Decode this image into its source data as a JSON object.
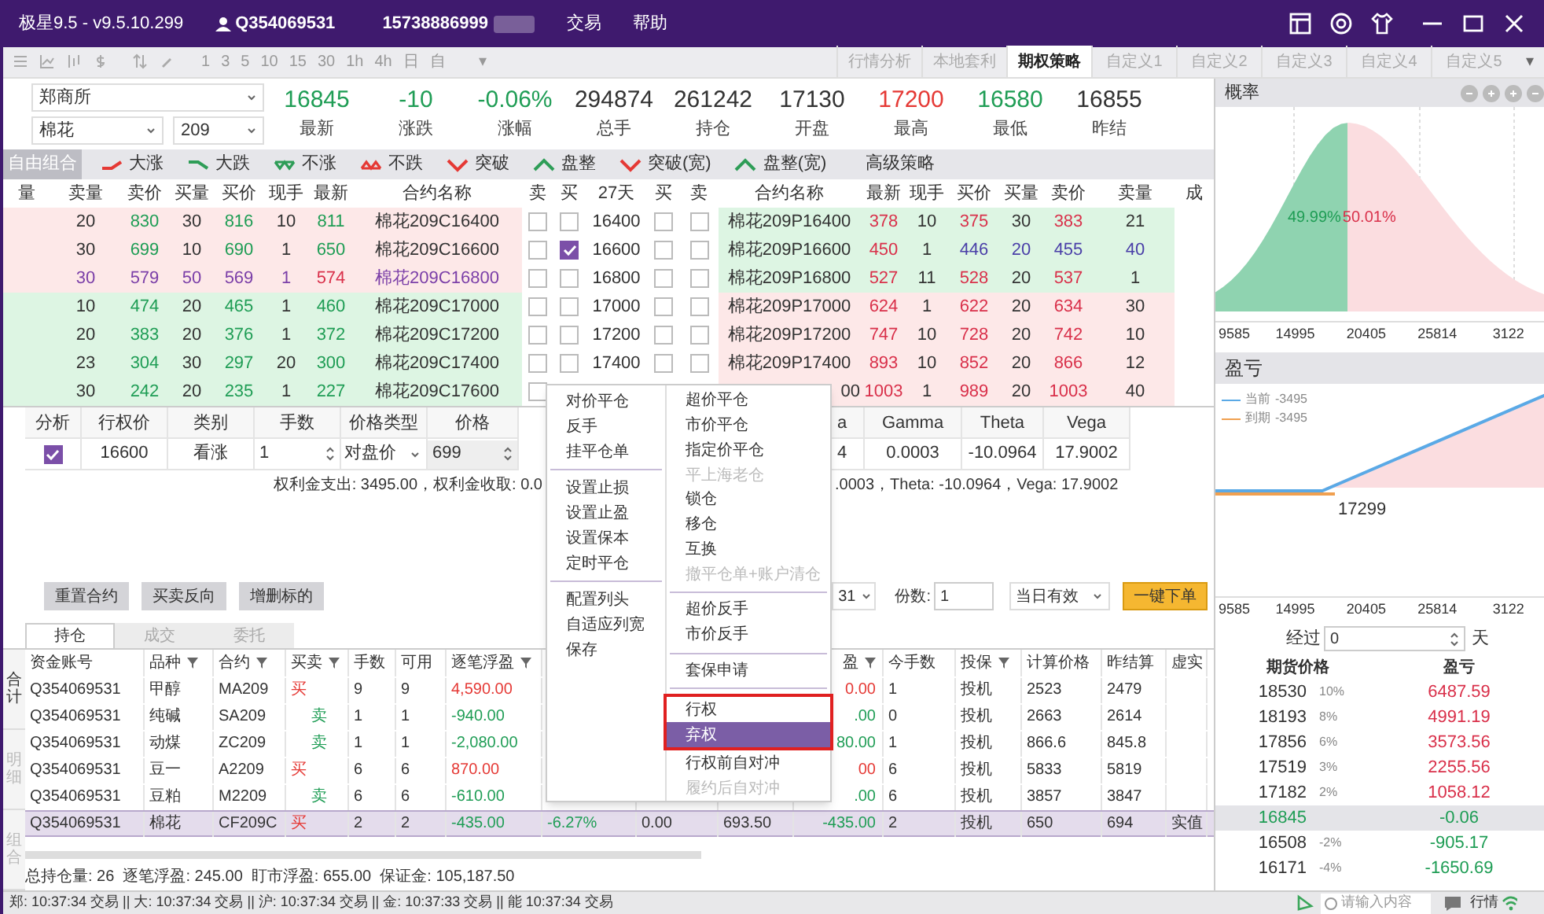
{
  "window": {
    "title": "极星9.5 - v9.5.10.299",
    "account": "Q354069531",
    "phone": "15738886999",
    "menu": [
      "交易",
      "帮助"
    ]
  },
  "toolbar": {
    "periods": [
      "1",
      "3",
      "5",
      "10",
      "15",
      "30",
      "1h",
      "4h",
      "日",
      "自"
    ],
    "more": "▾"
  },
  "tabs": [
    {
      "label": "行情分析",
      "selected": false
    },
    {
      "label": "本地套利",
      "selected": false
    },
    {
      "label": "期权策略",
      "selected": true
    },
    {
      "label": "自定义1",
      "selected": false
    },
    {
      "label": "自定义2",
      "selected": false
    },
    {
      "label": "自定义3",
      "selected": false
    },
    {
      "label": "自定义4",
      "selected": false
    },
    {
      "label": "自定义5",
      "selected": false
    }
  ],
  "tabs_more": "▾",
  "quote": {
    "exchange": "郑商所",
    "product": "棉花",
    "month": "209",
    "stats": [
      {
        "value": "16845",
        "label": "最新",
        "color": "#1f9d55"
      },
      {
        "value": "-10",
        "label": "涨跌",
        "color": "#1f9d55"
      },
      {
        "value": "-0.06%",
        "label": "涨幅",
        "color": "#1f9d55"
      },
      {
        "value": "294874",
        "label": "总手",
        "color": "#333333"
      },
      {
        "value": "261242",
        "label": "持仓",
        "color": "#333333"
      },
      {
        "value": "17130",
        "label": "开盘",
        "color": "#333333"
      },
      {
        "value": "17200",
        "label": "最高",
        "color": "#e53935"
      },
      {
        "value": "16580",
        "label": "最低",
        "color": "#1f9d55"
      },
      {
        "value": "16855",
        "label": "昨结",
        "color": "#333333"
      }
    ]
  },
  "strategies": [
    {
      "label": "自由组合",
      "kind": "plain",
      "selected": true
    },
    {
      "label": "大涨",
      "kind": "rise",
      "selected": false
    },
    {
      "label": "大跌",
      "kind": "fall",
      "selected": false
    },
    {
      "label": "不涨",
      "kind": "notrise",
      "selected": false
    },
    {
      "label": "不跌",
      "kind": "notfall",
      "selected": false
    },
    {
      "label": "突破",
      "kind": "break",
      "selected": false
    },
    {
      "label": "盘整",
      "kind": "range",
      "selected": false
    },
    {
      "label": "突破(宽)",
      "kind": "break",
      "selected": false
    },
    {
      "label": "盘整(宽)",
      "kind": "range",
      "selected": false
    },
    {
      "label": "高级策略",
      "kind": "plain",
      "selected": false
    }
  ],
  "option_table": {
    "columns": [
      "量",
      "卖量",
      "卖价",
      "买量",
      "买价",
      "现手",
      "最新",
      "合约名称",
      "卖",
      "买",
      "27天",
      "买",
      "卖",
      "合约名称",
      "最新",
      "现手",
      "买价",
      "买量",
      "卖价",
      "卖量",
      "成"
    ],
    "rows": [
      {
        "call": [
          "20",
          "830",
          "30",
          "816",
          "10",
          "811",
          "棉花209C16400"
        ],
        "checked": [
          false,
          false,
          false,
          false
        ],
        "strike": "16400",
        "put": [
          "棉花209P16400",
          "378",
          "10",
          "375",
          "30",
          "383",
          "21"
        ],
        "call_itm": true,
        "put_itm": false,
        "call_marked": false,
        "put_marked": false,
        "call_last_down": false
      },
      {
        "call": [
          "30",
          "699",
          "10",
          "690",
          "1",
          "650",
          "棉花209C16600"
        ],
        "checked": [
          false,
          true,
          false,
          false
        ],
        "strike": "16600",
        "put": [
          "棉花209P16600",
          "450",
          "1",
          "446",
          "20",
          "455",
          "40"
        ],
        "call_itm": true,
        "put_itm": false,
        "call_marked": false,
        "put_marked": true,
        "call_last_down": false
      },
      {
        "call": [
          "30",
          "579",
          "50",
          "569",
          "1",
          "574",
          "棉花209C16800"
        ],
        "checked": [
          false,
          false,
          false,
          false
        ],
        "strike": "16800",
        "put": [
          "棉花209P16800",
          "527",
          "11",
          "528",
          "20",
          "537",
          "1"
        ],
        "call_itm": true,
        "put_itm": false,
        "call_marked": true,
        "put_marked": false,
        "call_last_down": true
      },
      {
        "call": [
          "10",
          "474",
          "20",
          "465",
          "1",
          "460",
          "棉花209C17000"
        ],
        "checked": [
          false,
          false,
          false,
          false
        ],
        "strike": "17000",
        "put": [
          "棉花209P17000",
          "624",
          "1",
          "622",
          "20",
          "634",
          "30"
        ],
        "call_itm": false,
        "put_itm": true,
        "call_marked": false,
        "put_marked": false,
        "call_last_down": false
      },
      {
        "call": [
          "20",
          "383",
          "20",
          "376",
          "1",
          "372",
          "棉花209C17200"
        ],
        "checked": [
          false,
          false,
          false,
          false
        ],
        "strike": "17200",
        "put": [
          "棉花209P17200",
          "747",
          "10",
          "728",
          "20",
          "742",
          "10"
        ],
        "call_itm": false,
        "put_itm": true,
        "call_marked": false,
        "put_marked": false,
        "call_last_down": false
      },
      {
        "call": [
          "23",
          "304",
          "30",
          "297",
          "20",
          "300",
          "棉花209C17400"
        ],
        "checked": [
          false,
          false,
          false,
          false
        ],
        "strike": "17400",
        "put": [
          "棉花209P17400",
          "893",
          "10",
          "852",
          "20",
          "866",
          "12"
        ],
        "call_itm": false,
        "put_itm": true,
        "call_marked": false,
        "put_marked": false,
        "call_last_down": false
      },
      {
        "call": [
          "30",
          "242",
          "20",
          "235",
          "1",
          "227",
          "棉花209C17600"
        ],
        "checked": [
          false
        ],
        "put": [
          "00",
          "1003",
          "1",
          "989",
          "20",
          "1003",
          "40"
        ],
        "call_itm": false,
        "put_itm": true,
        "call_marked": false,
        "put_marked": false,
        "call_last_down": false
      }
    ]
  },
  "order": {
    "columns": [
      "分析",
      "行权价",
      "类别",
      "手数",
      "价格类型",
      "价格",
      "a",
      "Gamma",
      "Theta",
      "Vega"
    ],
    "row": {
      "analyze": true,
      "strike": "16600",
      "type": "看涨",
      "lots": "1",
      "price_type": "对盘价",
      "price": "699",
      "column_7": "4",
      "gamma": "0.0003",
      "theta": "-10.0964",
      "vega": "17.9002"
    },
    "summary_left": "权利金支出: 3495.00，权利金收取: 0.0",
    "summary_right": ".0003，Theta: -10.0964，Vega: 17.9002",
    "buttons": [
      "重置合约",
      "买卖反向",
      "增删标的"
    ],
    "column_dropdown": "31",
    "copies_label": "份数:",
    "copies": "1",
    "validity": "当日有效",
    "submit": "一键下单"
  },
  "positions": {
    "tabs": [
      {
        "label": "持仓",
        "selected": true
      },
      {
        "label": "成交",
        "selected": false
      },
      {
        "label": "委托",
        "selected": false
      }
    ],
    "side_tabs": [
      {
        "label": "合计",
        "selected": true
      },
      {
        "label": "明细",
        "selected": false
      },
      {
        "label": "组合",
        "selected": false
      }
    ],
    "columns": [
      "资金账号",
      "品种",
      "合约",
      "买卖",
      "手数",
      "可用",
      "逐笔浮盈",
      "盈",
      "今手数",
      "投保",
      "计算价格",
      "昨结算",
      "虚实"
    ],
    "rows": [
      {
        "account": "Q354069531",
        "product": "甲醇",
        "contract": "MA209",
        "side": "买",
        "buy": true,
        "lots": "9",
        "available": "9",
        "pnl": "4,590.00",
        "loss": false,
        "column_11": "0.00",
        "today": "1",
        "hedge": "投机",
        "calc_price": "2523",
        "prev_settle": "2479",
        "selected": false
      },
      {
        "account": "Q354069531",
        "product": "纯碱",
        "contract": "SA209",
        "side": "卖",
        "buy": false,
        "lots": "1",
        "available": "1",
        "pnl": "-940.00",
        "loss": true,
        "column_11": ".00",
        "today": "0",
        "hedge": "投机",
        "calc_price": "2663",
        "prev_settle": "2614",
        "selected": false
      },
      {
        "account": "Q354069531",
        "product": "动煤",
        "contract": "ZC209",
        "side": "卖",
        "buy": false,
        "lots": "1",
        "available": "1",
        "pnl": "-2,080.00",
        "loss": true,
        "column_11": "80.00",
        "today": "1",
        "hedge": "投机",
        "calc_price": "866.6",
        "prev_settle": "845.8",
        "selected": false
      },
      {
        "account": "Q354069531",
        "product": "豆一",
        "contract": "A2209",
        "side": "买",
        "buy": true,
        "lots": "6",
        "available": "6",
        "pnl": "870.00",
        "loss": false,
        "column_11": "00",
        "today": "6",
        "hedge": "投机",
        "calc_price": "5833",
        "prev_settle": "5819",
        "selected": false
      },
      {
        "account": "Q354069531",
        "product": "豆粕",
        "contract": "M2209",
        "side": "卖",
        "buy": false,
        "lots": "6",
        "available": "6",
        "pnl": "-610.00",
        "loss": true,
        "column_11": ".00",
        "today": "6",
        "hedge": "投机",
        "calc_price": "3857",
        "prev_settle": "3847",
        "selected": false
      },
      {
        "account": "Q354069531",
        "product": "棉花",
        "contract": "CF209C",
        "side": "买",
        "buy": true,
        "lots": "2",
        "available": "2",
        "pnl": "-435.00",
        "loss": true,
        "column_8": "-6.27%",
        "column_9": "0.00",
        "column_10": "693.50",
        "column_11": "-435.00",
        "today": "2",
        "hedge": "投机",
        "calc_price": "650",
        "prev_settle": "694",
        "column_16": "实值",
        "selected": true
      }
    ],
    "summary": "总持仓量: 26  逐笔浮盈: 245.00  盯市浮盈: 655.00  保证金: 105,187.50"
  },
  "context_menu": {
    "left": [
      {
        "kind": "item",
        "label": "对价平仓"
      },
      {
        "kind": "item",
        "label": "反手"
      },
      {
        "kind": "item",
        "label": "挂平仓单"
      },
      {
        "kind": "separator"
      },
      {
        "kind": "item",
        "label": "设置止损"
      },
      {
        "kind": "item",
        "label": "设置止盈"
      },
      {
        "kind": "item",
        "label": "设置保本"
      },
      {
        "kind": "item",
        "label": "定时平仓"
      },
      {
        "kind": "separator"
      },
      {
        "kind": "item",
        "label": "配置列头"
      },
      {
        "kind": "item",
        "label": "自适应列宽"
      },
      {
        "kind": "item",
        "label": "保存"
      }
    ],
    "right": [
      {
        "kind": "item",
        "label": "超价平仓",
        "disabled": false,
        "selected": false,
        "framed": false
      },
      {
        "kind": "item",
        "label": "市价平仓",
        "disabled": false,
        "selected": false,
        "framed": false
      },
      {
        "kind": "item",
        "label": "指定价平仓",
        "disabled": false,
        "selected": false,
        "framed": false
      },
      {
        "kind": "item",
        "label": "平上海老仓",
        "disabled": true,
        "selected": false,
        "framed": false
      },
      {
        "kind": "item",
        "label": "锁仓",
        "disabled": false,
        "selected": false,
        "framed": false
      },
      {
        "kind": "item",
        "label": "移仓",
        "disabled": false,
        "selected": false,
        "framed": false
      },
      {
        "kind": "item",
        "label": "互换",
        "disabled": false,
        "selected": false,
        "framed": false
      },
      {
        "kind": "item",
        "label": "撤平仓单+账户清仓",
        "disabled": true,
        "selected": false,
        "framed": false
      },
      {
        "kind": "separator"
      },
      {
        "kind": "item",
        "label": "超价反手",
        "disabled": false,
        "selected": false,
        "framed": false
      },
      {
        "kind": "item",
        "label": "市价反手",
        "disabled": false,
        "selected": false,
        "framed": false
      },
      {
        "kind": "separator"
      },
      {
        "kind": "item",
        "label": "套保申请",
        "disabled": false,
        "selected": false,
        "framed": false
      },
      {
        "kind": "separator"
      },
      {
        "kind": "item",
        "label": "行权",
        "disabled": false,
        "selected": false,
        "framed": true
      },
      {
        "kind": "item",
        "label": "弃权",
        "disabled": false,
        "selected": true,
        "framed": true
      },
      {
        "kind": "item",
        "label": "行权前自对冲",
        "disabled": false,
        "selected": false,
        "framed": false
      },
      {
        "kind": "item",
        "label": "履约后自对冲",
        "disabled": true,
        "selected": false,
        "framed": false
      }
    ]
  },
  "probability": {
    "title": "概率",
    "left_share": "49.99%",
    "right_share": "50.01%",
    "axis": [
      "9585",
      "14995",
      "20405",
      "25814",
      "3122"
    ]
  },
  "pnl_chart": {
    "title": "盈亏",
    "legend": [
      {
        "label": "当前",
        "value": "-3495",
        "color": "#5aa9e6"
      },
      {
        "label": "到期",
        "value": "-3495",
        "color": "#f0a050"
      }
    ],
    "breakeven": "17299",
    "axis": [
      "9585",
      "14995",
      "20405",
      "25814",
      "3122"
    ]
  },
  "scenario": {
    "elapsed_label": "经过",
    "elapsed": "0",
    "unit": "天",
    "columns": [
      "期货价格",
      "盈亏"
    ],
    "rows": [
      {
        "price": "18530",
        "change": "10%",
        "pnl": "6487.59",
        "loss": false,
        "current": false
      },
      {
        "price": "18193",
        "change": "8%",
        "pnl": "4991.19",
        "loss": false,
        "current": false
      },
      {
        "price": "17856",
        "change": "6%",
        "pnl": "3573.56",
        "loss": false,
        "current": false
      },
      {
        "price": "17519",
        "change": "3%",
        "pnl": "2255.56",
        "loss": false,
        "current": false
      },
      {
        "price": "17182",
        "change": "2%",
        "pnl": "1058.12",
        "loss": false,
        "current": false
      },
      {
        "price": "16845",
        "pnl": "-0.06",
        "loss": true,
        "current": true
      },
      {
        "price": "16508",
        "change": "-2%",
        "pnl": "-905.17",
        "loss": true,
        "current": false
      },
      {
        "price": "16171",
        "change": "-4%",
        "pnl": "-1650.69",
        "loss": true,
        "current": false
      }
    ]
  },
  "status_bar": {
    "text": "郑: 10:37:34 交易 || 大: 10:37:34 交易 || 沪: 10:37:34 交易 || 金: 10:37:33 交易 || 能 10:37:34 交易",
    "search_placeholder": "请输入内容",
    "market": "行情"
  }
}
